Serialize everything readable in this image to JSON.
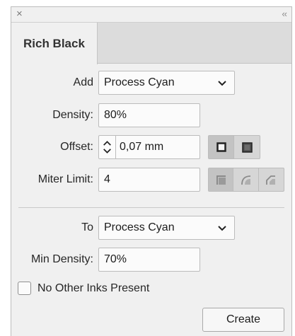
{
  "window": {
    "close_glyph": "×",
    "collapse_glyph": "‹‹"
  },
  "tab": {
    "label": "Rich Black"
  },
  "add": {
    "label": "Add",
    "value": "Process Cyan"
  },
  "density": {
    "label": "Density:",
    "value": "80%"
  },
  "offset": {
    "label": "Offset:",
    "value": "0,07 mm",
    "style_icons": [
      "outset-stroke-icon",
      "inset-stroke-icon"
    ]
  },
  "miter": {
    "label": "Miter Limit:",
    "value": "4",
    "join_icons": [
      "miter-join-icon",
      "round-join-icon",
      "bevel-join-icon"
    ]
  },
  "to": {
    "label": "To",
    "value": "Process Cyan"
  },
  "min_density": {
    "label": "Min Density:",
    "value": "70%"
  },
  "no_other_inks": {
    "label": "No Other Inks Present",
    "checked": false
  },
  "create": {
    "label": "Create"
  }
}
